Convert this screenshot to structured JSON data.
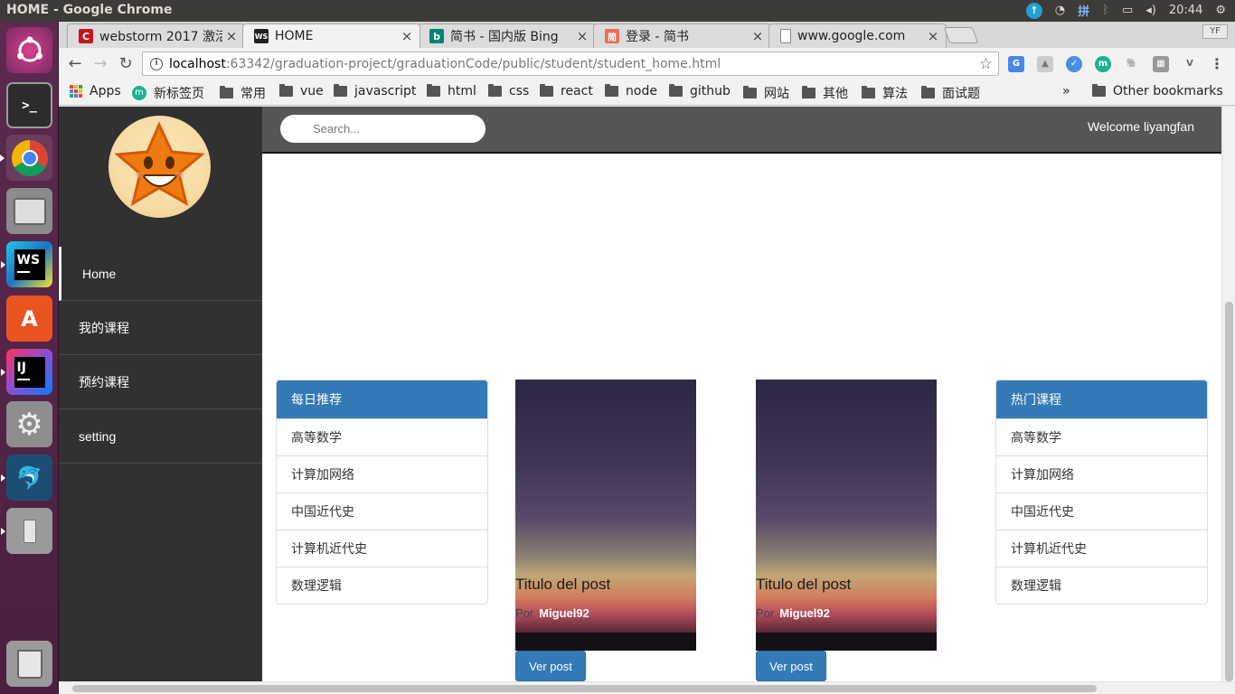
{
  "os": {
    "window_title": "HOME - Google Chrome",
    "ime": "拼",
    "clock": "20:44"
  },
  "launcher": [
    "dash-icon",
    "terminal-icon",
    "chrome-icon",
    "files-icon",
    "webstorm-icon",
    "software-center-icon",
    "intellij-icon",
    "system-settings-icon",
    "mysql-workbench-icon",
    "usb-drive-icon",
    "trash-icon"
  ],
  "browser": {
    "tabs": [
      {
        "title": "webstorm 2017 激活",
        "fav": "C",
        "color": "#c4161c"
      },
      {
        "title": "HOME",
        "fav": "WS",
        "color": "#222222"
      },
      {
        "title": "简书 - 国内版 Bing",
        "fav": "b",
        "color": "#008373"
      },
      {
        "title": "登录 - 简书",
        "fav": "简",
        "color": "#ea6f5a"
      },
      {
        "title": "www.google.com",
        "fav": "",
        "color": "#888888"
      }
    ],
    "profile": "YF",
    "url_host": "localhost",
    "url_path": ":63342/graduation-project/graduationCode/public/student/student_home.html",
    "bookmarks": [
      "Apps",
      "新标签页",
      "常用",
      "vue",
      "javascript",
      "html",
      "css",
      "react",
      "node",
      "github",
      "网站",
      "其他",
      "算法",
      "面试题"
    ],
    "bookmarks_more": "»",
    "other_bookmarks": "Other bookmarks"
  },
  "page": {
    "nav": [
      "Home",
      "我的课程",
      "预约课程",
      "setting"
    ],
    "search_placeholder": "Search...",
    "welcome": "Welcome liyangfan",
    "left_panel": {
      "title": "每日推荐",
      "items": [
        "高等数学",
        "计算加网络",
        "中国近代史",
        "计算机近代史",
        "数理逻辑"
      ]
    },
    "right_panel": {
      "title": "热门课程",
      "items": [
        "高等数学",
        "计算加网络",
        "中国近代史",
        "计算机近代史",
        "数理逻辑"
      ]
    },
    "cards": [
      {
        "title": "Titulo del post",
        "by": "Por",
        "author": "Miguel92",
        "button": "Ver post"
      },
      {
        "title": "Titulo del post",
        "by": "Por",
        "author": "Miguel92",
        "button": "Ver post"
      }
    ],
    "accent": "#337ab7"
  }
}
